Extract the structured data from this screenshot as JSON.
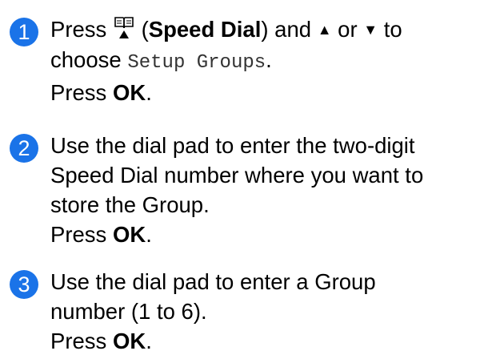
{
  "colors": {
    "badge": "#1a73e8",
    "text": "#000000",
    "lcd_text": "#333333"
  },
  "steps": [
    {
      "number": "1",
      "line1": {
        "press": "Press ",
        "icon": "speed-dial-book-icon",
        "paren_open": " (",
        "key": "Speed Dial",
        "paren_close": ") and ",
        "up": "▲",
        "or": " or ",
        "down": "▼",
        "to": " to"
      },
      "line2": {
        "choose": "choose ",
        "lcd": "Setup Groups",
        "period": "."
      },
      "line3": {
        "press": "Press ",
        "key": "OK",
        "period": "."
      }
    },
    {
      "number": "2",
      "lines": [
        "Use the dial pad to enter the two-digit",
        "Speed Dial number where you want to",
        "store the Group."
      ],
      "press_line": {
        "press": "Press ",
        "key": "OK",
        "period": "."
      }
    },
    {
      "number": "3",
      "lines": [
        "Use the dial pad to enter a Group",
        "number (1 to 6)."
      ],
      "press_line": {
        "press": "Press ",
        "key": "OK",
        "period": "."
      }
    }
  ]
}
